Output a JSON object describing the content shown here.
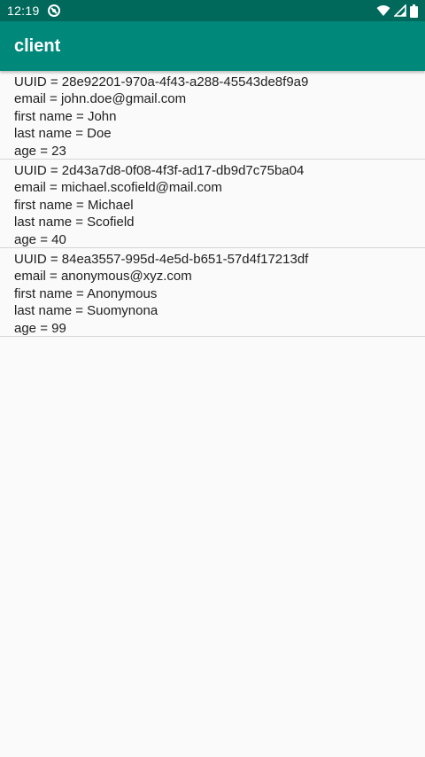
{
  "status_bar": {
    "time": "12:19",
    "icons": [
      "sync-icon",
      "wifi-icon",
      "signal-icon",
      "battery-icon"
    ]
  },
  "app_bar": {
    "title": "client"
  },
  "clients": [
    {
      "uuid": "UUID = 28e92201-970a-4f43-a288-45543de8f9a9",
      "email": "email = john.doe@gmail.com",
      "first_name": "first name = John",
      "last_name": "last name = Doe",
      "age": "age = 23"
    },
    {
      "uuid": "UUID = 2d43a7d8-0f08-4f3f-ad17-db9d7c75ba04",
      "email": "email = michael.scofield@mail.com",
      "first_name": "first name = Michael",
      "last_name": "last name = Scofield",
      "age": "age = 40"
    },
    {
      "uuid": "UUID = 84ea3557-995d-4e5d-b651-57d4f17213df",
      "email": "email = anonymous@xyz.com",
      "first_name": "first name = Anonymous",
      "last_name": "last name = Suomynona",
      "age": "age = 99"
    }
  ],
  "colors": {
    "status_bar": "#00695c",
    "app_bar": "#00897b",
    "background": "#fafafa",
    "text": "#212121",
    "divider": "#d6d6d6"
  }
}
